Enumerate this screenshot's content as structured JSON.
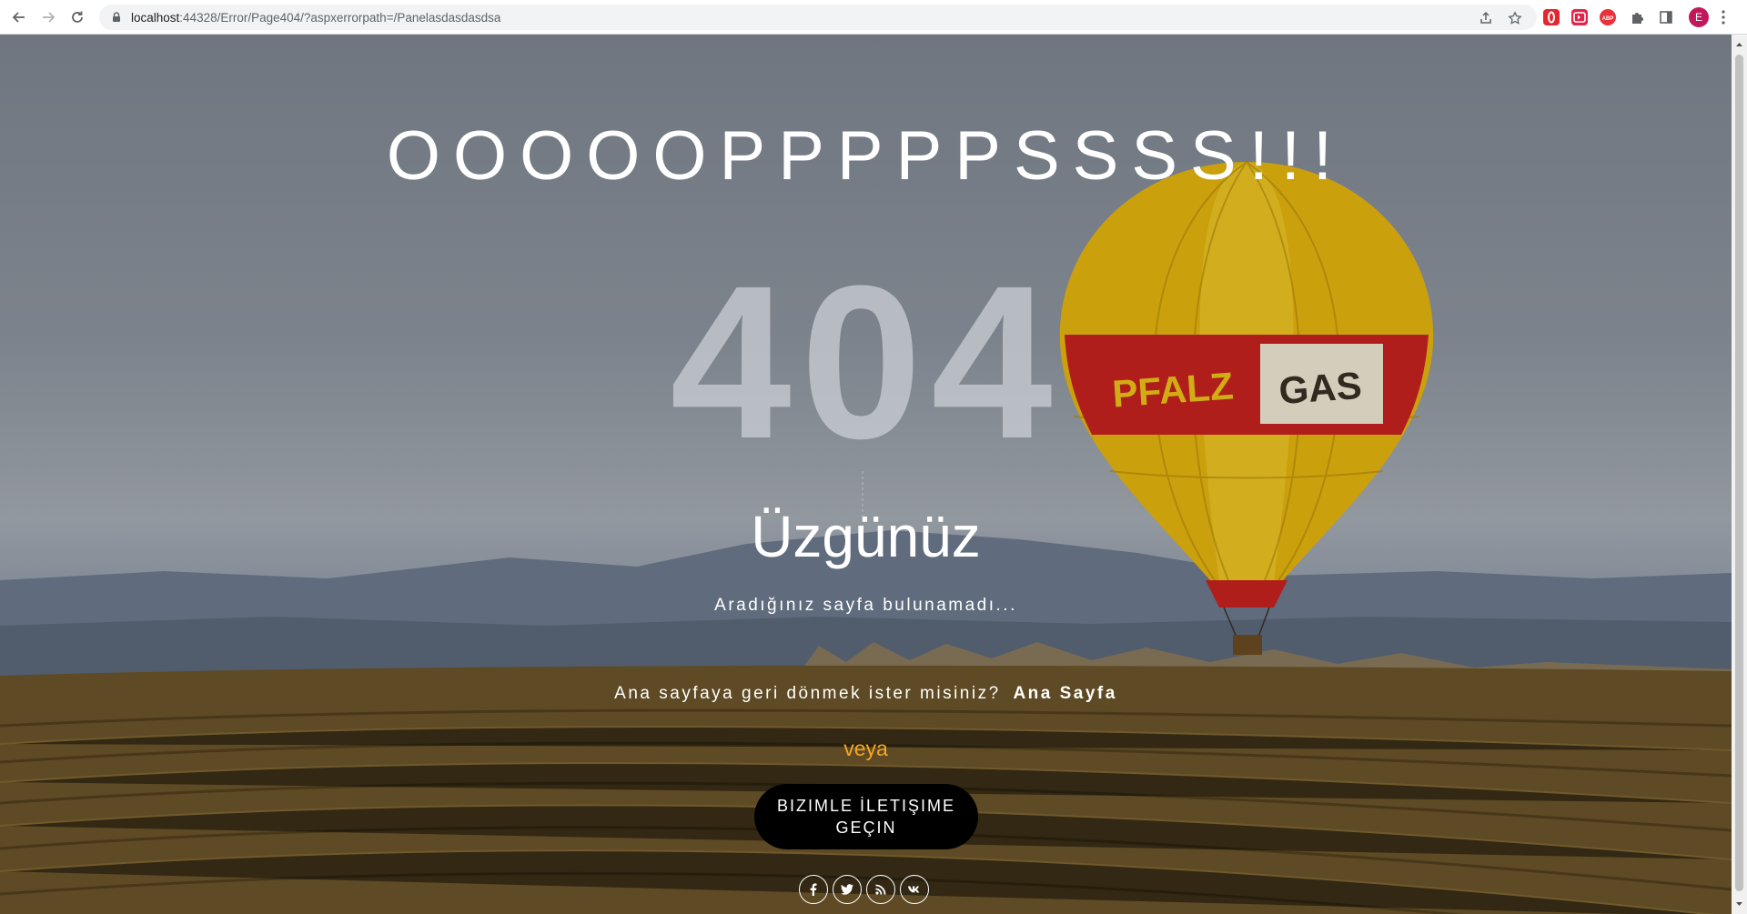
{
  "browser": {
    "url_host": "localhost",
    "url_rest": ":44328/Error/Page404/?aspxerrorpath=/Panelasdasdasdsa",
    "profile_initial": "E",
    "extensions": [
      "opera-icon",
      "pocket-icon",
      "adblock-icon",
      "puzzle-icon"
    ],
    "extension_labels": {
      "adblock": "ABP"
    }
  },
  "page": {
    "oops": "OOOOOPPPPPSSSS!!!",
    "code": "404",
    "sorry": "Üzgünüz",
    "subtitle": "Aradığınız sayfa bulunamadı...",
    "home_question": "Ana sayfaya geri dönmek ister misiniz?",
    "home_link": "Ana Sayfa",
    "or": "veya",
    "contact_button": "BIZIMLE İLETIŞIME GEÇIN",
    "socials": [
      "facebook-icon",
      "twitter-icon",
      "rss-icon",
      "vk-icon"
    ]
  },
  "balloon": {
    "text_left": "PFALZ",
    "text_right": "GAS"
  },
  "colors": {
    "accent": "#f5a623",
    "balloon_yellow": "#e8b70f",
    "balloon_red": "#c8231e",
    "button_bg": "#000000"
  }
}
